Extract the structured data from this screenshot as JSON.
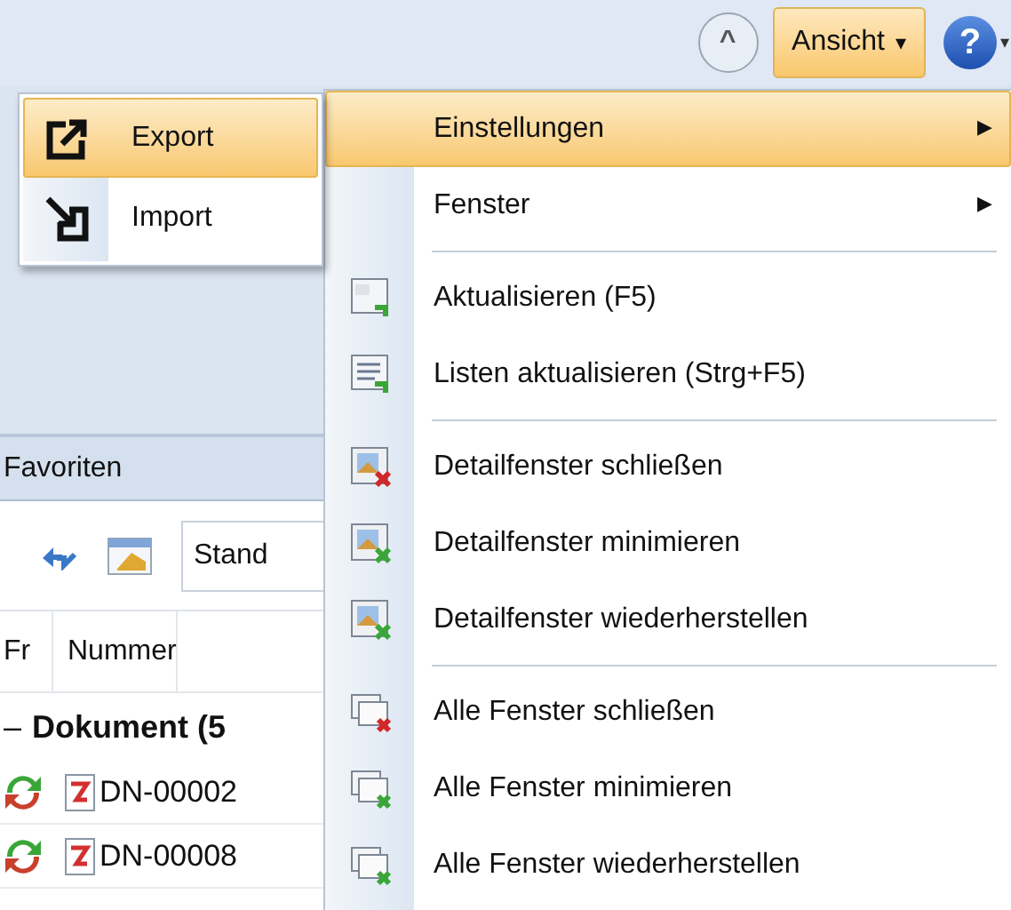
{
  "toolbar": {
    "collapse_button": "^",
    "view_button": {
      "label": "Ansicht",
      "caret": "▾",
      "selected": true
    },
    "help_button": {
      "label": "?",
      "caret": "▾"
    }
  },
  "favorites": {
    "title": "Favoriten",
    "view_field": {
      "value": "Stand"
    }
  },
  "table": {
    "columns": [
      "Fr",
      "Nummer"
    ],
    "group": {
      "toggle": "–",
      "label": "Dokument (5"
    },
    "rows": [
      {
        "nummer": "DN-00002"
      },
      {
        "nummer": "DN-00008"
      }
    ]
  },
  "view_menu": {
    "items": [
      {
        "kind": "submenu",
        "label": "Einstellungen",
        "arrow": "▶",
        "selected": true
      },
      {
        "kind": "submenu",
        "label": "Fenster",
        "arrow": "▶",
        "selected": false
      },
      {
        "kind": "separator"
      },
      {
        "kind": "command",
        "label": "Aktualisieren (F5)",
        "selected": false
      },
      {
        "kind": "command",
        "label": "Listen aktualisieren (Strg+F5)",
        "selected": false
      },
      {
        "kind": "separator"
      },
      {
        "kind": "command",
        "label": "Detailfenster schließen",
        "selected": false
      },
      {
        "kind": "command",
        "label": "Detailfenster minimieren",
        "selected": false
      },
      {
        "kind": "command",
        "label": "Detailfenster wiederherstellen",
        "selected": false
      },
      {
        "kind": "separator"
      },
      {
        "kind": "command",
        "label": "Alle Fenster schließen",
        "selected": false
      },
      {
        "kind": "command",
        "label": "Alle Fenster minimieren",
        "selected": false
      },
      {
        "kind": "command",
        "label": "Alle Fenster wiederherstellen",
        "selected": false
      }
    ]
  },
  "settings_submenu": {
    "items": [
      {
        "label": "Export",
        "selected": true
      },
      {
        "label": "Import",
        "selected": false
      }
    ]
  }
}
